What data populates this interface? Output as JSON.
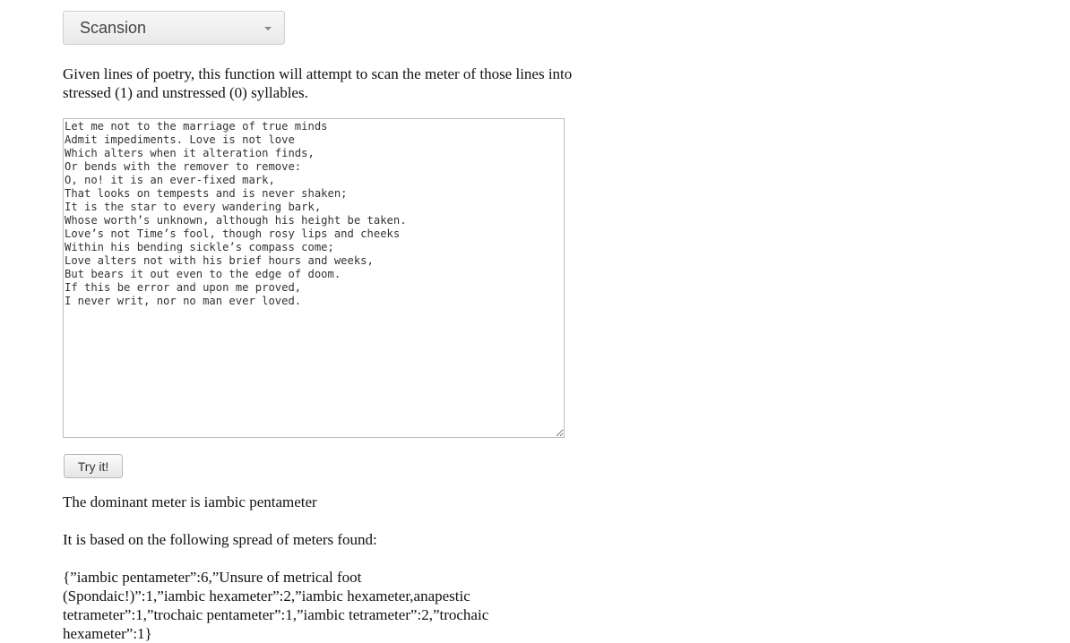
{
  "function_select": {
    "selected": "Scansion"
  },
  "description": "Given lines of poetry, this function will attempt to scan the meter of those lines into stressed (1) and unstressed (0) syllables.",
  "poem_input": {
    "value": "Let me not to the marriage of true minds\nAdmit impediments. Love is not love\nWhich alters when it alteration finds,\nOr bends with the remover to remove:\nO, no! it is an ever-fixed mark,\nThat looks on tempests and is never shaken;\nIt is the star to every wandering bark,\nWhose worth’s unknown, although his height be taken.\nLove’s not Time’s fool, though rosy lips and cheeks\nWithin his bending sickle’s compass come;\nLove alters not with his brief hours and weeks,\nBut bears it out even to the edge of doom.\nIf this be error and upon me proved,\nI never writ, nor no man ever loved."
  },
  "try_button": {
    "label": "Try it!"
  },
  "result": {
    "dominant": "The dominant meter is iambic pentameter",
    "based_on": "It is based on the following spread of meters found:",
    "spread": "{”iambic pentameter”:6,”Unsure of metrical foot (Spondaic!)”:1,”iambic hexameter”:2,”iambic hexameter,anapestic tetrameter”:1,”trochaic pentameter”:1,”iambic tetrameter”:2,”trochaic hexameter”:1}"
  }
}
